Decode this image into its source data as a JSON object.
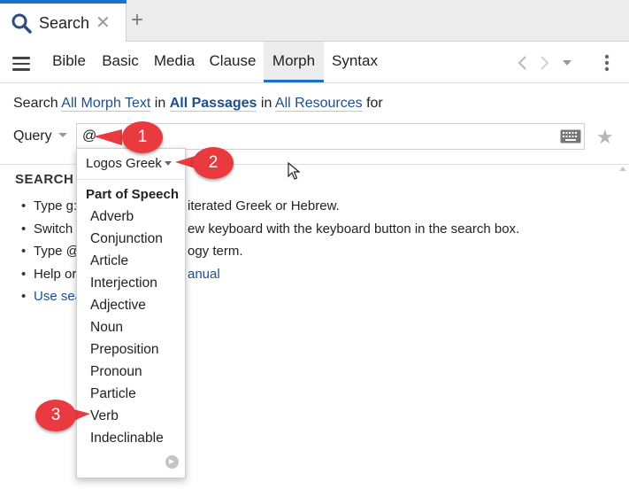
{
  "tab": {
    "label": "Search",
    "close": "✕",
    "new_tab": "+"
  },
  "nav": {
    "tabs": [
      {
        "label": "Bible",
        "active": false
      },
      {
        "label": "Basic",
        "active": false
      },
      {
        "label": "Media",
        "active": false
      },
      {
        "label": "Clause",
        "active": false
      },
      {
        "label": "Morph",
        "active": true
      },
      {
        "label": "Syntax",
        "active": false
      }
    ],
    "icons": [
      "hamburger-menu-icon",
      "back-arrow-icon",
      "forward-arrow-icon",
      "dropdown-caret-icon",
      "kebab-menu-icon"
    ]
  },
  "search_line": {
    "prefix": "Search",
    "target": "All Morph Text",
    "in1": "in",
    "passages": "All Passages",
    "in2": "in",
    "resources": "All Resources",
    "suffix": "for"
  },
  "query": {
    "label": "Query",
    "value": "@",
    "icons": [
      "keyboard-icon",
      "star-icon"
    ]
  },
  "help": {
    "title": "SEARCH H",
    "items": [
      {
        "prefix": "Type g:",
        "rest": "iterated Greek or Hebrew."
      },
      {
        "prefix": "Switch",
        "rest": "ew keyboard with the keyboard button in the search box."
      },
      {
        "prefix": "Type @",
        "rest": "ogy term."
      },
      {
        "prefix": "Help or",
        "rest": "anual"
      },
      {
        "prefix": "Use sea",
        "rest": ""
      }
    ]
  },
  "popup": {
    "language": "Logos Greek",
    "section": "Part of Speech",
    "items": [
      "Adverb",
      "Conjunction",
      "Article",
      "Interjection",
      "Adjective",
      "Noun",
      "Preposition",
      "Pronoun",
      "Particle",
      "Verb",
      "Indeclinable"
    ]
  },
  "callouts": [
    "1",
    "2",
    "3"
  ],
  "colors": {
    "accent": "#1a73c8",
    "link": "#1c4f8a",
    "callout": "#e83a3f"
  }
}
